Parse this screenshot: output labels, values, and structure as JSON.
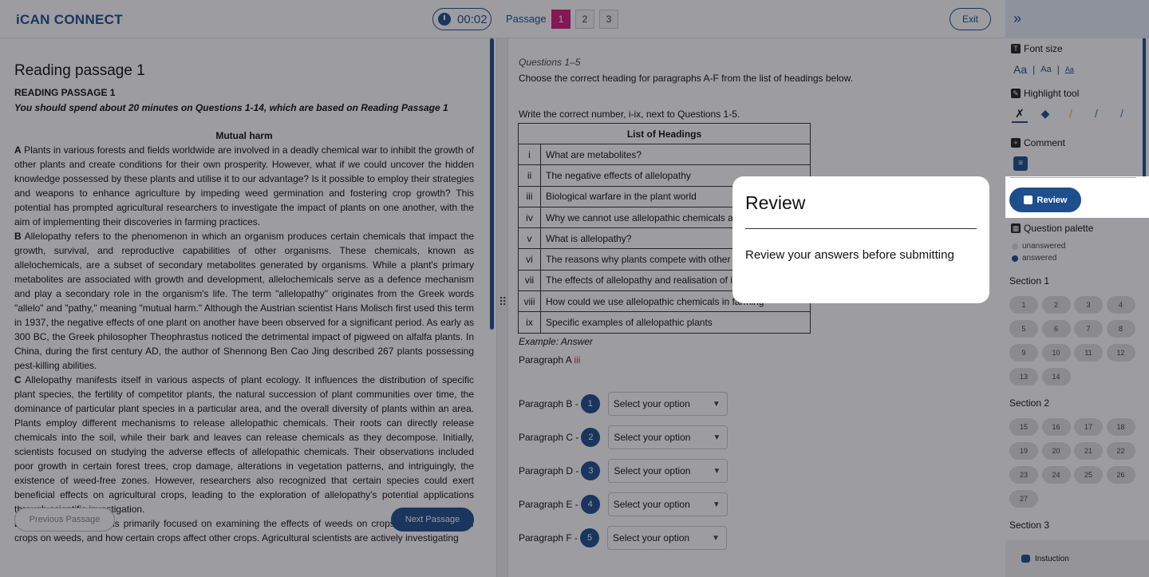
{
  "header": {
    "logo": "iCAN CONNECT",
    "timer": "00:02",
    "passage_label": "Passage",
    "passages": [
      "1",
      "2",
      "3"
    ],
    "active_passage": "1",
    "exit": "Exit",
    "collapse_icon": "double-chevron-right-icon"
  },
  "passage": {
    "title": "Reading passage 1",
    "heading": "READING PASSAGE 1",
    "instruction": "You should spend about 20 minutes on Questions 1-14, which are based on Reading Passage 1",
    "article_title": "Mutual harm",
    "paragraphs": [
      {
        "letter": "A",
        "text": " Plants in various forests and fields worldwide are involved in a deadly chemical war to inhibit the growth of other plants and create conditions for their own prosperity. However, what if we could uncover the hidden knowledge possessed by these plants and utilise it to our advantage? Is it possible to employ their strategies and weapons to enhance agriculture by impeding weed germination and fostering crop growth? This potential has prompted agricultural researchers to investigate the impact of plants on one another, with the aim of implementing their discoveries in farming practices."
      },
      {
        "letter": "B",
        "text": " Allelopathy refers to the phenomenon in which an organism produces certain chemicals that impact the growth, survival, and reproductive capabilities of other organisms. These chemicals, known as allelochemicals, are a subset of secondary metabolites generated by organisms. While a plant's primary metabolites are associated with growth and development, allelochemicals serve as a defence mechanism and play a secondary role in the organism's life. The term \"allelopathy\" originates from the Greek words \"allelo\" and \"pathy,\" meaning \"mutual harm.\" Although the Austrian scientist Hans Molisch first used this term in 1937, the negative effects of one plant on another have been observed for a significant period. As early as 300 BC, the Greek philosopher Theophrastus noticed the detrimental impact of pigweed on alfalfa plants. In China, during the first century AD, the author of Shennong Ben Cao Jing described 267 plants possessing pest-killing abilities."
      },
      {
        "letter": "C",
        "text": " Allelopathy manifests itself in various aspects of plant ecology. It influences the distribution of specific plant species, the fertility of competitor plants, the natural succession of plant communities over time, the dominance of particular plant species in a particular area, and the overall diversity of plants within an area. Plants employ different mechanisms to release allelopathic chemicals. Their roots can directly release chemicals into the soil, while their bark and leaves can release chemicals as they decompose. Initially, scientists focused on studying the adverse effects of allelopathic chemicals. Their observations included poor growth in certain forest trees, crop damage, alterations in vegetation patterns, and intriguingly, the existence of weed-free zones. However, researchers also recognized that certain species could exert beneficial effects on agricultural crops, leading to the exploration of allelopathy's potential applications through scientific investigation."
      },
      {
        "letter": "D",
        "text": " Presently, research is primarily focused on examining the effects of weeds on crops, the influences of crops on weeds, and how certain crops affect other crops. Agricultural scientists are actively investigating"
      }
    ],
    "prev_button": "Previous Passage",
    "next_button": "Next Passage"
  },
  "questions": {
    "range": "Questions 1–5",
    "instruction": "Choose the correct heading for paragraphs A-F from the list of headings below.",
    "instruction2": "Write the correct number, i-ix, next to Questions 1-5.",
    "table_title": "List of Headings",
    "headings": [
      {
        "num": "i",
        "text": "What are metabolites?"
      },
      {
        "num": "ii",
        "text": "The negative effects of allelopathy"
      },
      {
        "num": "iii",
        "text": "Biological warfare in the plant world"
      },
      {
        "num": "iv",
        "text": "Why we cannot use allelopathic chemicals at the moment"
      },
      {
        "num": "v",
        "text": "What is allelopathy?"
      },
      {
        "num": "vi",
        "text": "The reasons why plants compete with other plants"
      },
      {
        "num": "vii",
        "text": "The effects of allelopathy and realisation of its potential"
      },
      {
        "num": "viii",
        "text": "How could we use allelopathic chemicals in farming"
      },
      {
        "num": "ix",
        "text": "Specific examples of allelopathic plants"
      }
    ],
    "example_label": "Example: Answer",
    "example_para": "Paragraph A",
    "example_answer": "iii",
    "rows": [
      {
        "label": "Paragraph B -",
        "num": "1",
        "placeholder": "Select your option"
      },
      {
        "label": "Paragraph C -",
        "num": "2",
        "placeholder": "Select your option"
      },
      {
        "label": "Paragraph D -",
        "num": "3",
        "placeholder": "Select your option"
      },
      {
        "label": "Paragraph E -",
        "num": "4",
        "placeholder": "Select your option"
      },
      {
        "label": "Paragraph F -",
        "num": "5",
        "placeholder": "Select your option"
      }
    ]
  },
  "sidebar": {
    "font_size": "Font size",
    "font_options": [
      "Aa",
      "Aa",
      "Aa"
    ],
    "highlight": "Highlight tool",
    "comment": "Comment",
    "review": "Review",
    "palette": "Question palette",
    "unanswered": "unanswered",
    "answered": "answered",
    "sections": [
      {
        "title": "Section 1",
        "items": [
          "1",
          "2",
          "3",
          "4",
          "5",
          "6",
          "7",
          "8",
          "9",
          "10",
          "11",
          "12",
          "13",
          "14"
        ]
      },
      {
        "title": "Section 2",
        "items": [
          "15",
          "16",
          "17",
          "18",
          "19",
          "20",
          "21",
          "22",
          "23",
          "24",
          "25",
          "26",
          "27"
        ]
      },
      {
        "title": "Section 3",
        "items": []
      }
    ],
    "instruction_link": "Instuction"
  },
  "modal": {
    "title": "Review",
    "body": "Review your answers before submitting"
  }
}
